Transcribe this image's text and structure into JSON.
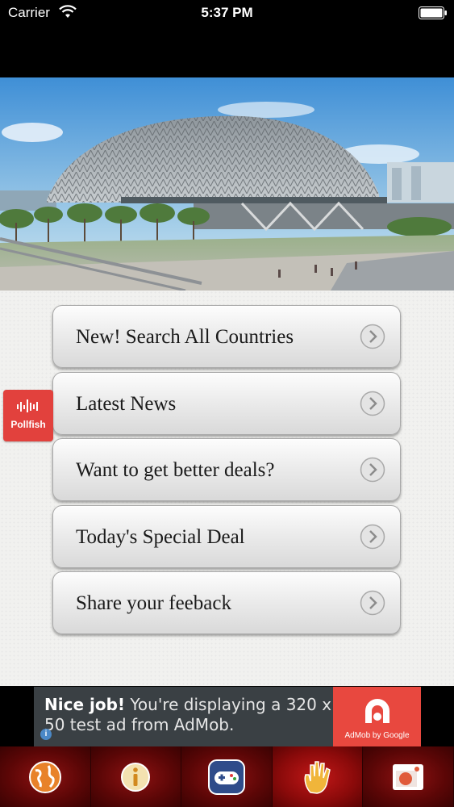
{
  "status_bar": {
    "carrier": "Carrier",
    "time": "5:37 PM"
  },
  "hero": {
    "image": "esplanade-theatres-photo"
  },
  "menu": [
    {
      "label": "New! Search All Countries"
    },
    {
      "label": "Latest News"
    },
    {
      "label": "Want to get better deals?"
    },
    {
      "label": "Today's Special Deal"
    },
    {
      "label": "Share your feeback"
    }
  ],
  "pollfish": {
    "label": "Pollfish"
  },
  "ad": {
    "headline": "Nice job!",
    "body": " You're displaying a 320 x 50 test ad from AdMob.",
    "brand": "AdMob by Google"
  },
  "tabbar": [
    {
      "icon": "globe-icon"
    },
    {
      "icon": "info-icon"
    },
    {
      "icon": "gamepad-icon"
    },
    {
      "icon": "hand-icon"
    },
    {
      "icon": "photo-icon"
    }
  ],
  "colors": {
    "accent_red": "#e2413d",
    "tab_red": "#8a0a0a",
    "admob_red": "#e8483f"
  }
}
